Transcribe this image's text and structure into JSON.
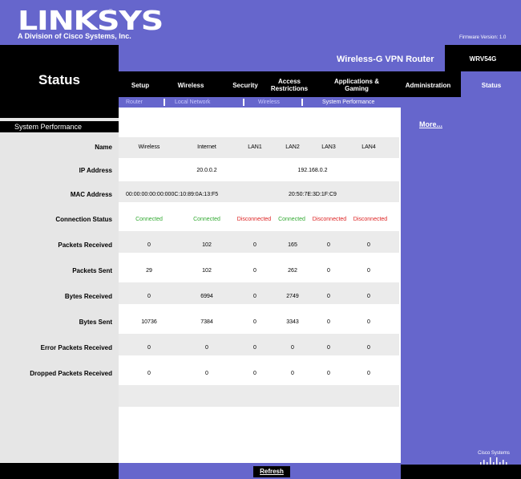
{
  "header": {
    "logo": "LINKSYS",
    "logo_reg": "®",
    "logo_sub": "A Division of Cisco Systems, Inc.",
    "firmware": "Firmware Version: 1.0",
    "product_name": "Wireless-G VPN Router",
    "model": "WRV54G",
    "page_title": "Status"
  },
  "tabs": [
    {
      "label": "Setup"
    },
    {
      "label": "Wireless"
    },
    {
      "label": "Security"
    },
    {
      "label": "Access Restrictions"
    },
    {
      "label": "Applications & Gaming"
    },
    {
      "label": "Administration"
    },
    {
      "label": "Status"
    }
  ],
  "subnav": [
    "Router",
    "Local Network",
    "Wireless",
    "System Performance"
  ],
  "section_title": "System Performance",
  "more_link": "More...",
  "table": {
    "row_labels": [
      "Name",
      "IP Address",
      "MAC Address",
      "Connection Status",
      "Packets Received",
      "Packets Sent",
      "Bytes Received",
      "Bytes Sent",
      "Error Packets Received",
      "Dropped Packets Received"
    ],
    "columns": [
      "Wireless",
      "Internet",
      "LAN1",
      "LAN2",
      "LAN3",
      "LAN4"
    ],
    "ip_internet": "20.0.0.2",
    "ip_lan": "192.168.0.2",
    "mac_wireless_internet": "00:00:00:00:00:000C:10:89:0A:13:F5",
    "mac_lan": "20:50:7E:3D:1F:C9",
    "connection_status": [
      "Connected",
      "Connected",
      "Disconnected",
      "Connected",
      "Disconnected",
      "Disconnected"
    ],
    "packets_received": [
      "0",
      "102",
      "0",
      "165",
      "0",
      "0"
    ],
    "packets_sent": [
      "29",
      "102",
      "0",
      "262",
      "0",
      "0"
    ],
    "bytes_received": [
      "0",
      "6994",
      "0",
      "2749",
      "0",
      "0"
    ],
    "bytes_sent": [
      "10736",
      "7384",
      "0",
      "3343",
      "0",
      "0"
    ],
    "error_packets_received": [
      "0",
      "0",
      "0",
      "0",
      "0",
      "0"
    ],
    "dropped_packets_received": [
      "0",
      "0",
      "0",
      "0",
      "0",
      "0"
    ]
  },
  "refresh_label": "Refresh",
  "cisco_logo": "Cisco Systems",
  "colors": {
    "brand": "#6666cc",
    "connected": "#33aa33",
    "disconnected": "#dd2222"
  }
}
